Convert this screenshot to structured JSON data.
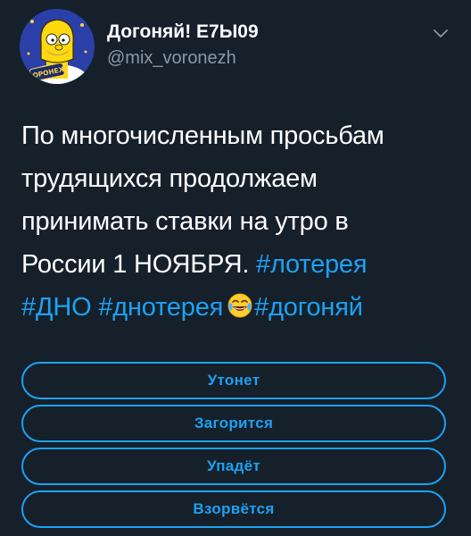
{
  "author": {
    "display_name": "Догоняй! E7Ы09",
    "handle": "@mix_voronezh",
    "avatar_badge_text": "ВОРОНЕЖ"
  },
  "tweet": {
    "lines": [
      {
        "text": "По многочисленным просьбам"
      },
      {
        "text": "трудящихся продолжаем"
      },
      {
        "text": "принимать ставки на утро в"
      },
      {
        "text": "России 1 НОЯБРЯ. ",
        "hashtag": "#лотерея"
      }
    ],
    "last_line": {
      "hashtag1": "#ДНО",
      "hashtag2": "#днотерея",
      "emoji": "face-with-tears-of-joy",
      "hashtag3": "#догоняй"
    }
  },
  "poll": {
    "options": [
      "Утонет",
      "Загорится",
      "Упадёт",
      "Взорвётся"
    ]
  },
  "colors": {
    "background": "#15202b",
    "accent": "#1da1f2",
    "secondary_text": "#8899a6",
    "primary_text": "#ffffff"
  },
  "icons": {
    "menu": "chevron-down-icon"
  }
}
